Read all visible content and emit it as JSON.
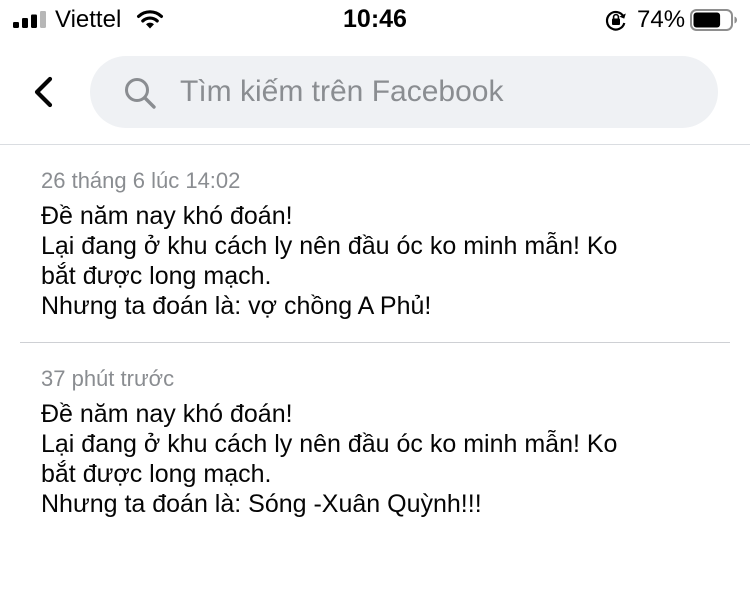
{
  "status_bar": {
    "carrier": "Viettel",
    "time": "10:46",
    "battery_percent": "74%",
    "battery_level": 0.74,
    "icons": [
      "signal-icon",
      "wifi-icon",
      "orientation-lock-icon",
      "battery-icon"
    ]
  },
  "header": {
    "back_icon": "chevron-left-icon",
    "search_icon": "search-icon",
    "search_placeholder": "Tìm kiếm trên Facebook",
    "search_value": ""
  },
  "revisions": [
    {
      "timestamp": "26 tháng 6 lúc 14:02",
      "lines": [
        "Đề năm nay khó đoán!",
        "Lại đang ở khu cách ly nên đầu óc ko minh mẫn! Ko",
        "bắt được long mạch.",
        "Nhưng ta đoán là: vợ chồng A Phủ!"
      ]
    },
    {
      "timestamp": "37 phút trước",
      "lines": [
        "Đề năm nay khó đoán!",
        "Lại đang ở khu cách ly nên đầu óc ko minh mẫn! Ko",
        "bắt được long mạch.",
        "Nhưng ta đoán là: Sóng -Xuân Quỳnh!!!"
      ]
    }
  ],
  "colors": {
    "search_background": "#eff1f4",
    "placeholder": "#8a8d91",
    "timestamp": "#8a8d91",
    "divider": "#ced0d4",
    "text": "#050505"
  }
}
